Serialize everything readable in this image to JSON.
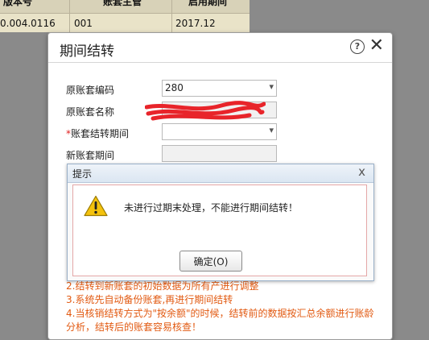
{
  "background_table": {
    "headers": [
      "版本号",
      "账套主管",
      "启用期间"
    ],
    "row": [
      "0.004.0116",
      "001",
      "2017.12"
    ]
  },
  "dialog": {
    "title": "期间结转",
    "form": {
      "source_code_label": "原账套编码",
      "source_code_value": "280",
      "source_name_label": "原账套名称",
      "source_name_value": "",
      "period_required_mark": "*",
      "period_label": "账套结转期间",
      "period_value": "",
      "new_period_label": "新账套期间",
      "new_period_value": ""
    },
    "notes": [
      "2.结转到新账套的初始数据为所有产进行调整",
      "3.系统先自动备份账套,再进行期间结转",
      "4.当核销结转方式为\"按余额\"的时候，结转前的数据按汇总余额进行账龄",
      "分析，结转后的账套容易核查！"
    ]
  },
  "alert": {
    "title": "提示",
    "close_symbol": "x",
    "message": "未进行过期末处理，不能进行期间结转！",
    "ok_label": "确定(O)"
  },
  "colors": {
    "required": "#e02020",
    "notes": "#e25a12",
    "redaction": "#e8242a"
  }
}
